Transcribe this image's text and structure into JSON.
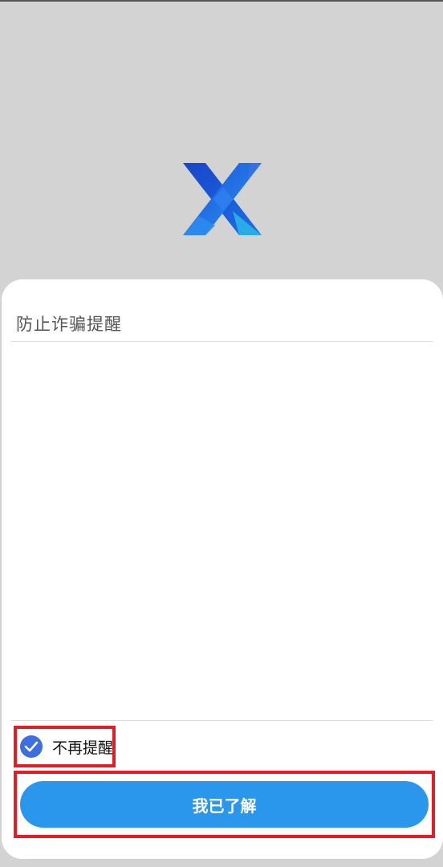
{
  "app": {
    "logo_icon": "x-logo-icon",
    "background_color": "#d3d3d3"
  },
  "dialog": {
    "title": "防止诈骗提醒",
    "checkbox": {
      "label": "不再提醒",
      "checked": true,
      "icon": "checkmark-icon",
      "color": "#3d6fe0"
    },
    "confirm_button": {
      "label": "我已了解",
      "color": "#2b97ec"
    },
    "highlight_color": "#e51c23"
  }
}
